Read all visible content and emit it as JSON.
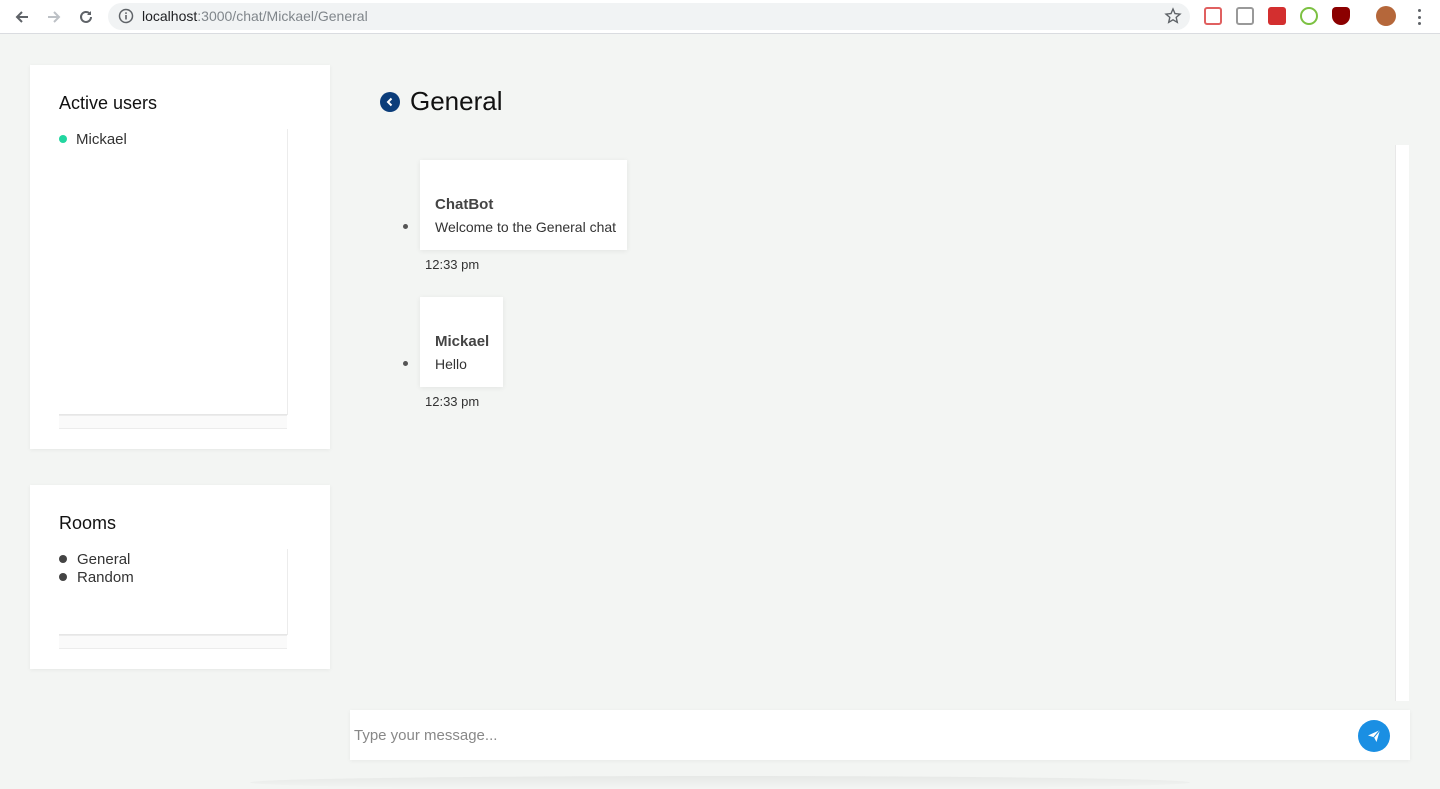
{
  "browser": {
    "url_host": "localhost",
    "url_path": ":3000/chat/Mickael/General",
    "icons": [
      "back-arrow-icon",
      "forward-arrow-icon",
      "reload-icon",
      "info-icon",
      "star-icon",
      "extension-icons",
      "profile-avatar",
      "menu-dots-icon"
    ]
  },
  "active_users": {
    "title": "Active users",
    "users": [
      {
        "name": "Mickael",
        "status_color": "#22d6a0"
      }
    ]
  },
  "rooms": {
    "title": "Rooms",
    "items": [
      {
        "name": "General"
      },
      {
        "name": "Random"
      }
    ]
  },
  "chat": {
    "title": "General",
    "messages": [
      {
        "author": "ChatBot",
        "text": "Welcome to the General chat",
        "time": "12:33 pm"
      },
      {
        "author": "Mickael",
        "text": "Hello",
        "time": "12:33 pm"
      }
    ]
  },
  "composer": {
    "placeholder": "Type your message..."
  },
  "colors": {
    "accent": "#1a8fe3",
    "back_icon": "#0b3d7a",
    "online": "#22d6a0",
    "background": "#f3f5f3"
  }
}
